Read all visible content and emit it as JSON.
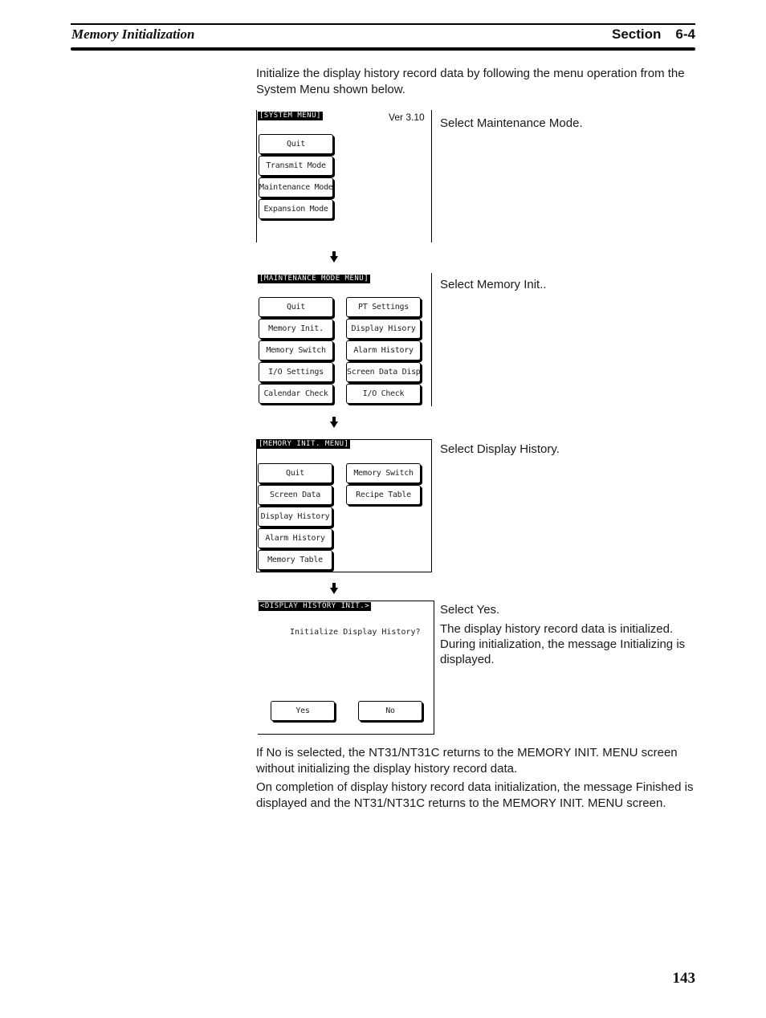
{
  "header": {
    "title": "Memory Initialization",
    "section_label": "Section",
    "section_number": "6-4"
  },
  "intro": "Initialize the display history record data by following the menu operation from the System Menu shown below.",
  "steps": [
    {
      "screen_title": "[SYSTEM MENU]",
      "version": "Ver 3.10",
      "buttons_left": [
        "Quit",
        "Transmit Mode",
        "Maintenance Mode",
        "Expansion Mode"
      ],
      "buttons_right": [],
      "caption": "Select Maintenance Mode."
    },
    {
      "screen_title": "[MAINTENANCE MODE MENU]",
      "buttons_left": [
        "Quit",
        "Memory Init.",
        "Memory Switch",
        "I/O Settings",
        "Calendar Check"
      ],
      "buttons_right": [
        "PT Settings",
        "Display Hisory",
        "Alarm History",
        "Screen Data Disp.",
        "I/O Check"
      ],
      "caption": "Select Memory Init.."
    },
    {
      "screen_title": "[MEMORY INIT. MENU]",
      "buttons_left": [
        "Quit",
        "Screen Data",
        "Display History",
        "Alarm History",
        "Memory Table"
      ],
      "buttons_right": [
        "Memory Switch",
        "Recipe Table"
      ],
      "caption": "Select Display History."
    },
    {
      "screen_title": "<DISPLAY HISTORY INIT.>",
      "prompt": "Initialize Display History?",
      "buttons": [
        "Yes",
        "No"
      ],
      "caption": "Select Yes.",
      "caption_detail": "The display history record data is initialized. During initialization, the message Initializing is displayed."
    }
  ],
  "outro": [
    "If No is selected, the NT31/NT31C returns to the MEMORY INIT. MENU screen without initializing the display history record data.",
    "On completion of display history record data initialization, the message Finished is displayed and the NT31/NT31C returns to the MEMORY INIT. MENU screen."
  ],
  "page_number": "143",
  "icons": {
    "step_arrow": "down-arrow-icon"
  }
}
